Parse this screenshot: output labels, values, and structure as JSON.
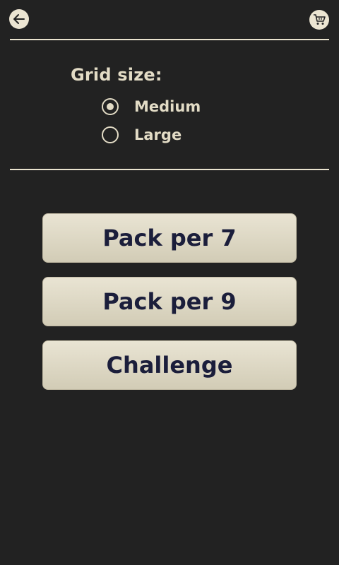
{
  "header": {
    "back_icon": "arrow-left-icon",
    "cart_icon": "shopping-cart-icon"
  },
  "grid_size": {
    "label": "Grid size:",
    "options": [
      {
        "label": "Medium",
        "selected": true
      },
      {
        "label": "Large",
        "selected": false
      }
    ]
  },
  "menu": {
    "buttons": [
      {
        "label": "Pack per 7"
      },
      {
        "label": "Pack per 9"
      },
      {
        "label": "Challenge"
      }
    ]
  },
  "colors": {
    "background": "#222222",
    "text": "#e3dcc6",
    "button_text": "#1b1e3b",
    "button_face": "#e0dac7"
  }
}
